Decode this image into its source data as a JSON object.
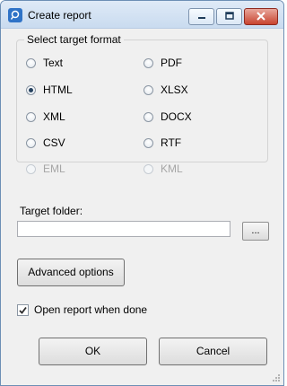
{
  "window": {
    "title": "Create report",
    "icon": "app-icon"
  },
  "format_group": {
    "legend": "Select target format",
    "options": [
      {
        "label": "Text"
      },
      {
        "label": "PDF"
      },
      {
        "label": "HTML",
        "checked": true
      },
      {
        "label": "XLSX"
      },
      {
        "label": "XML"
      },
      {
        "label": "DOCX"
      },
      {
        "label": "CSV"
      },
      {
        "label": "RTF"
      },
      {
        "label": "EML",
        "disabled": true
      },
      {
        "label": "KML",
        "disabled": true
      }
    ]
  },
  "target_folder": {
    "label": "Target folder:",
    "value": "",
    "browse_label": "..."
  },
  "advanced_button": "Advanced options",
  "open_when_done": {
    "label": "Open report when done",
    "checked": true
  },
  "ok_label": "OK",
  "cancel_label": "Cancel"
}
